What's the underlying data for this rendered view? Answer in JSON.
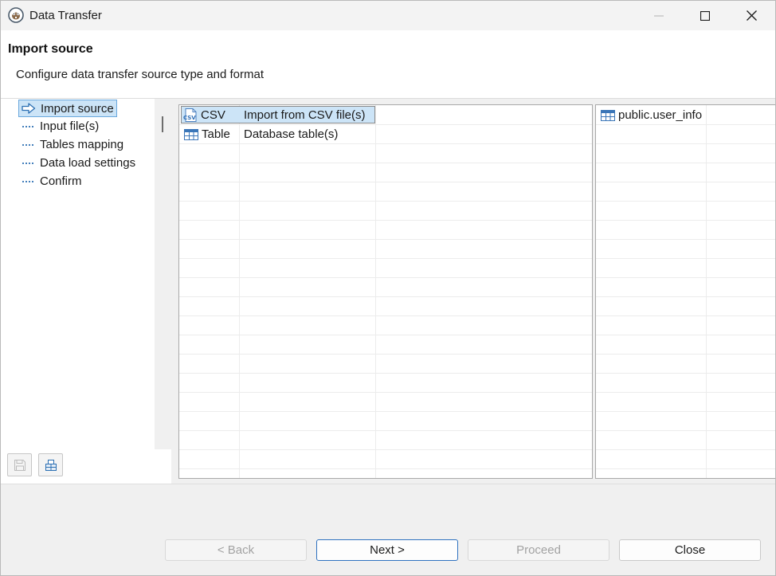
{
  "window": {
    "title": "Data Transfer",
    "icon": "dbeaver-beaver-icon"
  },
  "header": {
    "title": "Import source",
    "description": "Configure data transfer source type and format"
  },
  "nav": {
    "items": [
      {
        "label": "Import source",
        "selected": true
      },
      {
        "label": "Input file(s)",
        "selected": false
      },
      {
        "label": "Tables mapping",
        "selected": false
      },
      {
        "label": "Data load settings",
        "selected": false
      },
      {
        "label": "Confirm",
        "selected": false
      }
    ]
  },
  "sources": {
    "rows": [
      {
        "name": "CSV",
        "description": "Import from CSV file(s)",
        "icon": "csv-file-icon",
        "selected": true
      },
      {
        "name": "Table",
        "description": "Database table(s)",
        "icon": "table-icon",
        "selected": false
      }
    ]
  },
  "targets": {
    "rows": [
      {
        "name": "public.user_info",
        "icon": "table-icon"
      }
    ]
  },
  "footer": {
    "back": "< Back",
    "next": "Next >",
    "proceed": "Proceed",
    "close": "Close"
  },
  "colors": {
    "selection": "#cce4f7",
    "selection_border": "#6aa8dd",
    "accent": "#2f72c0"
  }
}
